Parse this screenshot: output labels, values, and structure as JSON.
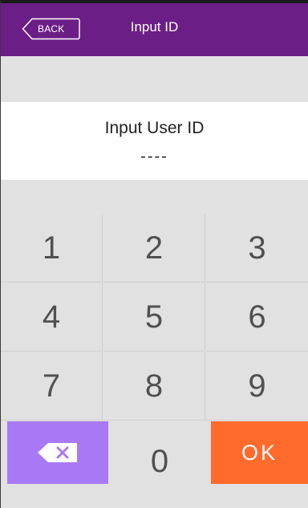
{
  "header": {
    "back_label": "BACK",
    "title": "Input ID"
  },
  "prompt": {
    "label": "Input User ID",
    "value": "----"
  },
  "keypad": {
    "keys": [
      "1",
      "2",
      "3",
      "4",
      "5",
      "6",
      "7",
      "8",
      "9",
      "0"
    ],
    "ok_label": "OK",
    "delete_icon": "backspace-icon"
  },
  "colors": {
    "header": "#6b1f86",
    "delete_key": "#a979f5",
    "ok_key": "#ff6a2d",
    "keypad_bg": "#e1e1e1"
  }
}
